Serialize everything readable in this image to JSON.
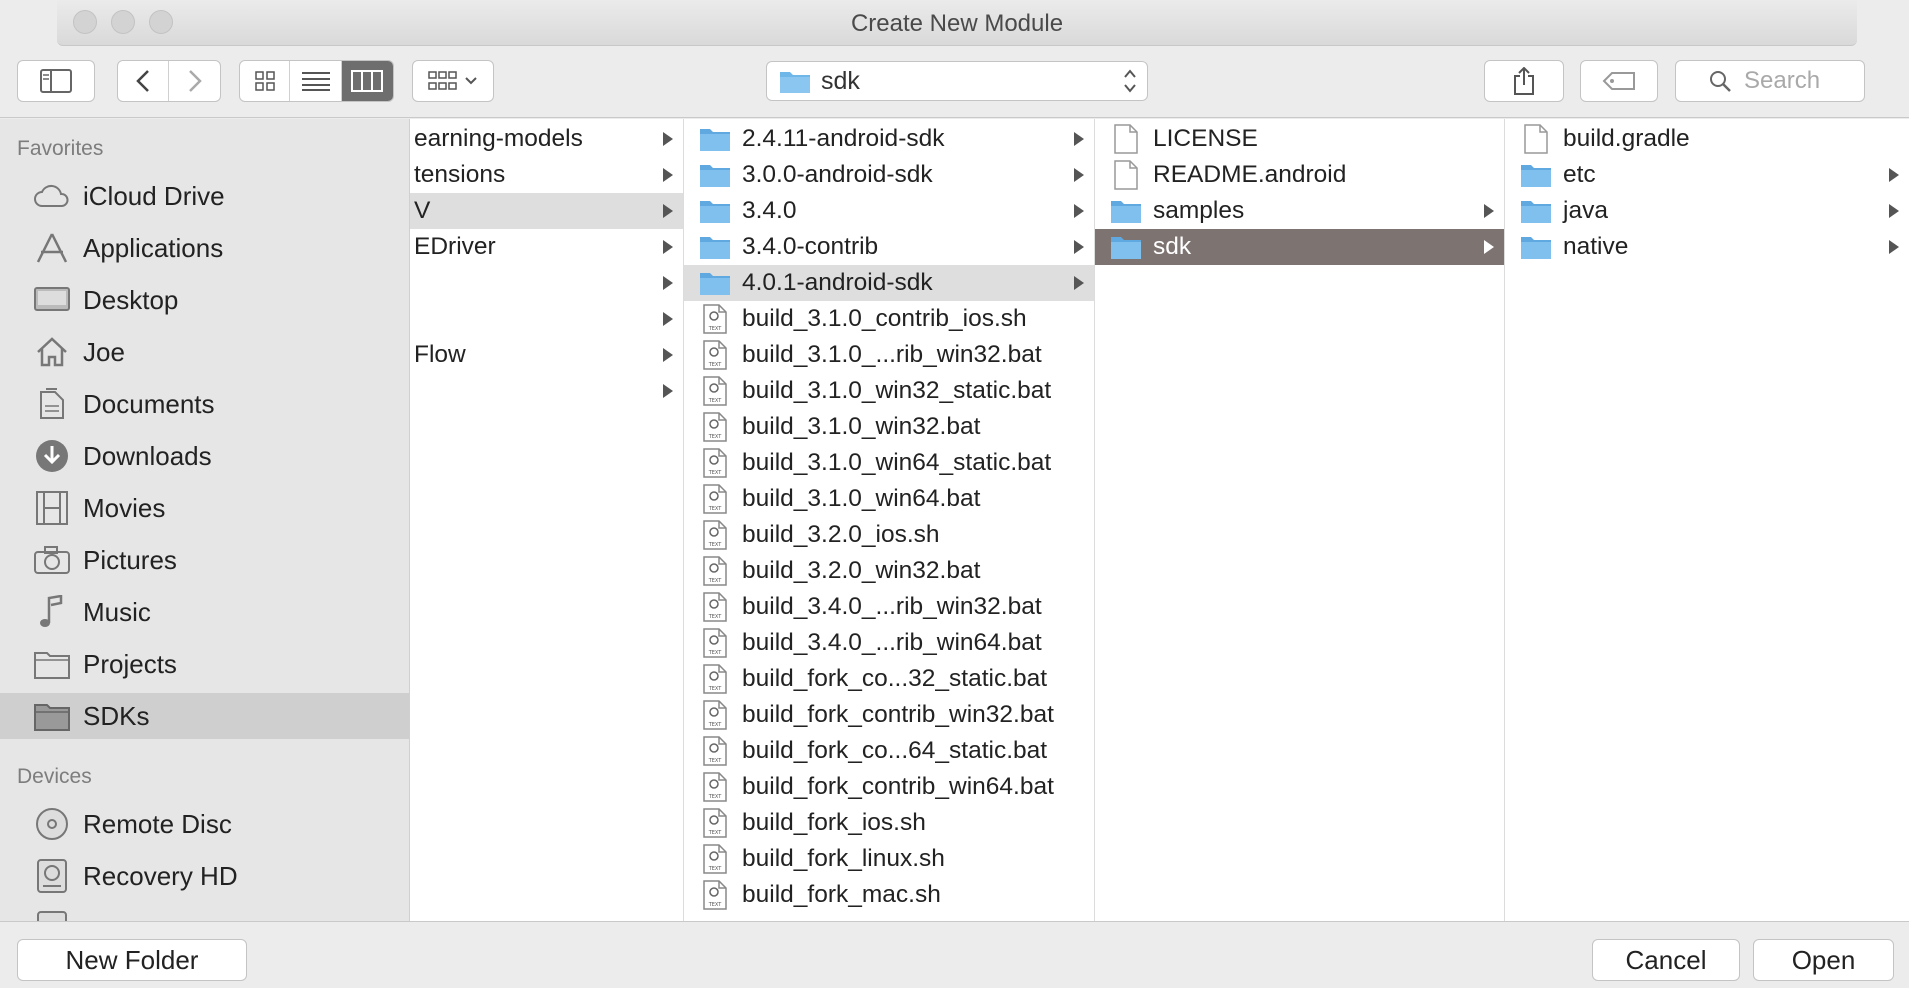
{
  "window": {
    "title": "Create New Module"
  },
  "toolbar": {
    "path_label": "sdk",
    "search_placeholder": "Search"
  },
  "sidebar": {
    "favorites_heading": "Favorites",
    "favorites": [
      {
        "label": "iCloud Drive",
        "icon": "cloud-icon"
      },
      {
        "label": "Applications",
        "icon": "applications-icon"
      },
      {
        "label": "Desktop",
        "icon": "desktop-icon"
      },
      {
        "label": "Joe",
        "icon": "home-icon"
      },
      {
        "label": "Documents",
        "icon": "documents-icon"
      },
      {
        "label": "Downloads",
        "icon": "downloads-icon"
      },
      {
        "label": "Movies",
        "icon": "movies-icon"
      },
      {
        "label": "Pictures",
        "icon": "camera-icon"
      },
      {
        "label": "Music",
        "icon": "music-note-icon"
      },
      {
        "label": "Projects",
        "icon": "folder-icon"
      },
      {
        "label": "SDKs",
        "icon": "folder-icon",
        "selected": true
      }
    ],
    "devices_heading": "Devices",
    "devices": [
      {
        "label": "Remote Disc",
        "icon": "disc-icon"
      },
      {
        "label": "Recovery HD",
        "icon": "drive-icon"
      }
    ]
  },
  "columns": {
    "col1": [
      {
        "label": "earning-models",
        "arrow": true
      },
      {
        "label": "tensions",
        "arrow": true
      },
      {
        "label": "V",
        "arrow": true,
        "highlight": true
      },
      {
        "label": "EDriver",
        "arrow": true
      },
      {
        "label": "",
        "arrow": true
      },
      {
        "label": "",
        "arrow": true
      },
      {
        "label": "Flow",
        "arrow": true
      },
      {
        "label": "",
        "arrow": true
      }
    ],
    "col2": [
      {
        "label": "2.4.11-android-sdk",
        "type": "folder",
        "arrow": true
      },
      {
        "label": "3.0.0-android-sdk",
        "type": "folder",
        "arrow": true
      },
      {
        "label": "3.4.0",
        "type": "folder",
        "arrow": true
      },
      {
        "label": "3.4.0-contrib",
        "type": "folder",
        "arrow": true
      },
      {
        "label": "4.0.1-android-sdk",
        "type": "folder",
        "arrow": true,
        "highlight": true
      },
      {
        "label": "build_3.1.0_contrib_ios.sh",
        "type": "text"
      },
      {
        "label": "build_3.1.0_...rib_win32.bat",
        "type": "text"
      },
      {
        "label": "build_3.1.0_win32_static.bat",
        "type": "text"
      },
      {
        "label": "build_3.1.0_win32.bat",
        "type": "text"
      },
      {
        "label": "build_3.1.0_win64_static.bat",
        "type": "text"
      },
      {
        "label": "build_3.1.0_win64.bat",
        "type": "text"
      },
      {
        "label": "build_3.2.0_ios.sh",
        "type": "text"
      },
      {
        "label": "build_3.2.0_win32.bat",
        "type": "text"
      },
      {
        "label": "build_3.4.0_...rib_win32.bat",
        "type": "text"
      },
      {
        "label": "build_3.4.0_...rib_win64.bat",
        "type": "text"
      },
      {
        "label": "build_fork_co...32_static.bat",
        "type": "text"
      },
      {
        "label": "build_fork_contrib_win32.bat",
        "type": "text"
      },
      {
        "label": "build_fork_co...64_static.bat",
        "type": "text"
      },
      {
        "label": "build_fork_contrib_win64.bat",
        "type": "text"
      },
      {
        "label": "build_fork_ios.sh",
        "type": "text"
      },
      {
        "label": "build_fork_linux.sh",
        "type": "text"
      },
      {
        "label": "build_fork_mac.sh",
        "type": "text"
      }
    ],
    "col3": [
      {
        "label": "LICENSE",
        "type": "doc"
      },
      {
        "label": "README.android",
        "type": "doc"
      },
      {
        "label": "samples",
        "type": "folder",
        "arrow": true
      },
      {
        "label": "sdk",
        "type": "folder",
        "arrow": true,
        "selected": true
      }
    ],
    "col4": [
      {
        "label": "build.gradle",
        "type": "doc"
      },
      {
        "label": "etc",
        "type": "folder",
        "arrow": true
      },
      {
        "label": "java",
        "type": "folder",
        "arrow": true
      },
      {
        "label": "native",
        "type": "folder",
        "arrow": true
      }
    ]
  },
  "bottom": {
    "new_folder_label": "New Folder",
    "cancel_label": "Cancel",
    "open_label": "Open"
  },
  "colors": {
    "selection_bg": "#7d7371",
    "folder_blue": "#6fb7e9",
    "sidebar_selected": "#cfcfcf"
  }
}
